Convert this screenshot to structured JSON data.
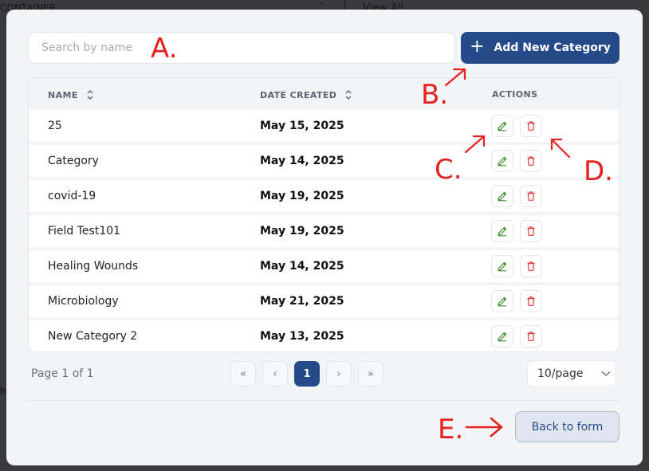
{
  "background": {
    "container_label": "CONTAINER",
    "view_all_label": "View All",
    "left_char": "h"
  },
  "search": {
    "placeholder": "Search by name",
    "value": ""
  },
  "add_button": {
    "label": "Add New Category",
    "icon": "plus-icon"
  },
  "table": {
    "headers": {
      "name": "NAME",
      "date": "DATE CREATED",
      "actions": "ACTIONS"
    },
    "rows": [
      {
        "name": "25",
        "date": "May 15, 2025"
      },
      {
        "name": "Category",
        "date": "May 14, 2025"
      },
      {
        "name": "covid-19",
        "date": "May 19, 2025"
      },
      {
        "name": "Field Test101",
        "date": "May 19, 2025"
      },
      {
        "name": "Healing Wounds",
        "date": "May 14, 2025"
      },
      {
        "name": "Microbiology",
        "date": "May 21, 2025"
      },
      {
        "name": "New Category 2",
        "date": "May 13, 2025"
      }
    ]
  },
  "pagination": {
    "label": "Page 1 of 1",
    "current_page": "1",
    "first": "«",
    "prev": "‹",
    "next": "›",
    "last": "»",
    "page_size": "10/page"
  },
  "back_button": {
    "label": "Back to form"
  },
  "annotations": {
    "a": "A.",
    "b": "B.",
    "c": "C.",
    "d": "D.",
    "e": "E."
  },
  "colors": {
    "primary": "#254a8a",
    "edit": "#3f8f2c",
    "delete": "#e03c3c",
    "annotation": "#e8201f"
  }
}
